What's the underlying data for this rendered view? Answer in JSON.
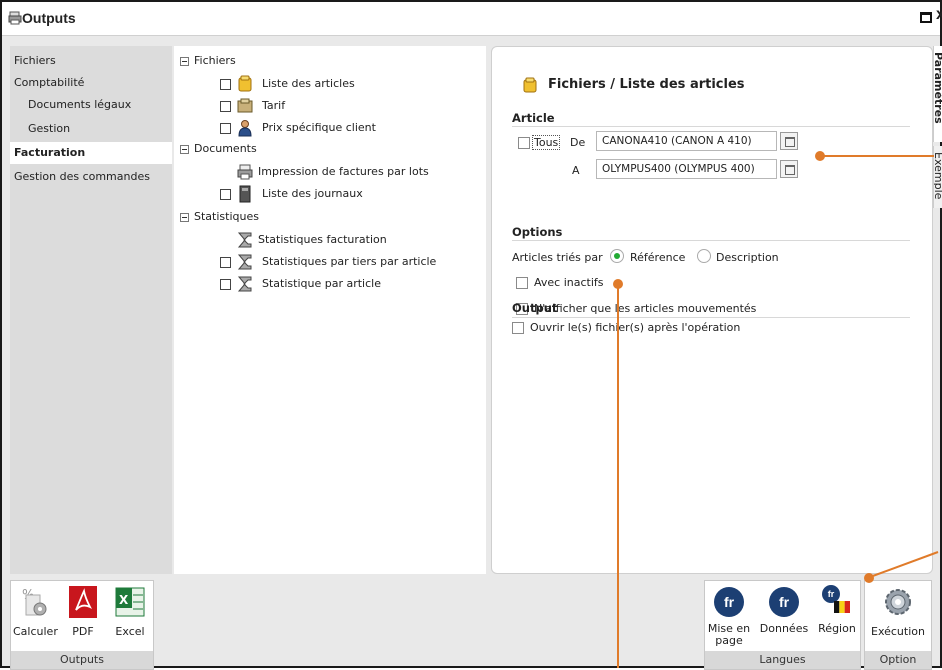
{
  "window": {
    "title": "Outputs"
  },
  "nav": {
    "items": [
      {
        "label": "Fichiers"
      },
      {
        "label": "Comptabilité"
      },
      {
        "label": "Documents légaux"
      },
      {
        "label": "Gestion"
      },
      {
        "label": "Facturation"
      },
      {
        "label": "Gestion des commandes"
      }
    ]
  },
  "tree": {
    "groups": [
      {
        "label": "Fichiers",
        "items": [
          "Liste des articles",
          "Tarif",
          "Prix spécifique client"
        ]
      },
      {
        "label": "Documents",
        "items": [
          "Impression de factures par lots",
          "Liste des journaux"
        ]
      },
      {
        "label": "Statistiques",
        "items": [
          "Statistiques facturation",
          "Statistiques par tiers par article",
          "Statistique par article"
        ]
      }
    ]
  },
  "params": {
    "title": "Fichiers / Liste des articles",
    "article": {
      "section": "Article",
      "tous_label": "Tous",
      "de_label": "De",
      "de_value": "CANONA410 (CANON A 410)",
      "a_label": "A",
      "a_value": "OLYMPUS400 (OLYMPUS 400)"
    },
    "options": {
      "section": "Options",
      "sort_label": "Articles triés par",
      "sort_options": [
        "Référence",
        "Description"
      ],
      "sort_selected": "Référence",
      "inactive_label": "Avec inactifs",
      "moved_label": "N'afficher que les articles mouvementés"
    },
    "output": {
      "section": "Output",
      "open_label": "Ouvrir le(s) fichier(s) après l'opération"
    }
  },
  "sidetabs": {
    "parametres": "Paramètres",
    "exemple": "Exemple"
  },
  "ribbon": {
    "outputs": {
      "caption": "Outputs",
      "buttons": [
        "Calculer",
        "PDF",
        "Excel"
      ]
    },
    "langues": {
      "caption": "Langues",
      "buttons": [
        "Mise en page",
        "Données",
        "Région"
      ],
      "lang_code": "fr"
    },
    "option": {
      "caption": "Option",
      "buttons": [
        "Exécution"
      ]
    }
  },
  "colors": {
    "accent_orange": "#e07b2a",
    "radio_green": "#22aa33",
    "lang_blue": "#1c3f73"
  }
}
